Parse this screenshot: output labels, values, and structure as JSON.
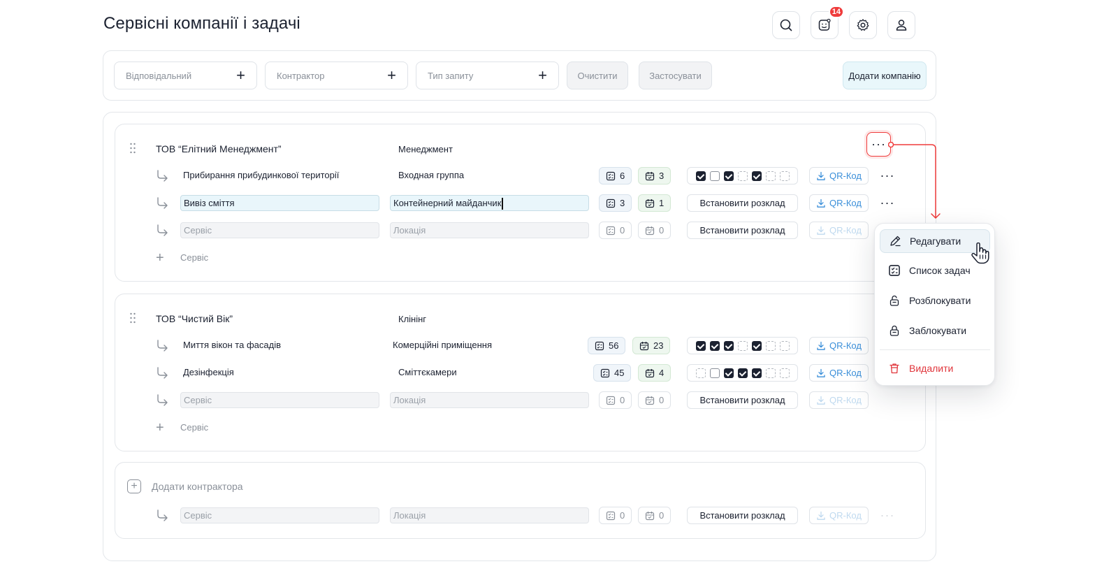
{
  "header": {
    "title": "Сервісні компанії і задачі",
    "notifications_badge": "14"
  },
  "filters": {
    "responsible": "Відповідальний",
    "contractor": "Контрактор",
    "request_type": "Тип запиту",
    "clear_label": "Очистити",
    "apply_label": "Застосувати",
    "add_company_label": "Додати компанію"
  },
  "companies": [
    {
      "name": "ТОВ “Елітний Менеджмент”",
      "category": "Менеджмент",
      "services": [
        {
          "name": "Прибирання прибудинкової території",
          "location": "Входная группа",
          "tasks": "6",
          "schedules": "3",
          "days": [
            "on",
            "off",
            "on",
            "dash",
            "on",
            "dash",
            "dash"
          ],
          "qr_label": "QR-Код"
        },
        {
          "name": "Вивіз сміття",
          "location": "Контейнерний майданчик",
          "tasks": "3",
          "schedules": "1",
          "schedule_label": "Встановити розклад",
          "qr_label": "QR-Код"
        },
        {
          "name_placeholder": "Сервіс",
          "location_placeholder": "Локація",
          "tasks": "0",
          "schedules": "0",
          "schedule_label": "Встановити розклад",
          "qr_label": "QR-Код"
        }
      ],
      "add_service_label": "Сервіс"
    },
    {
      "name": "ТОВ “Чистий Вік”",
      "category": "Клінінг",
      "services": [
        {
          "name": "Миття вікон та фасадів",
          "location": "Комерційні приміщення",
          "tasks": "56",
          "schedules": "23",
          "days": [
            "on",
            "on",
            "on",
            "dash",
            "on",
            "dash",
            "dash"
          ],
          "qr_label": "QR-Код"
        },
        {
          "name": "Дезінфекція",
          "location": "Сміттєкамери",
          "tasks": "45",
          "schedules": "4",
          "days": [
            "dash",
            "off",
            "on",
            "on",
            "on",
            "dash",
            "dash"
          ],
          "qr_label": "QR-Код"
        },
        {
          "name_placeholder": "Сервіс",
          "location_placeholder": "Локація",
          "tasks": "0",
          "schedules": "0",
          "schedule_label": "Встановити розклад",
          "qr_label": "QR-Код"
        }
      ],
      "add_service_label": "Сервіс"
    }
  ],
  "add_contractor": {
    "label": "Додати контрактора",
    "service_placeholder": "Сервіс",
    "location_placeholder": "Локація",
    "tasks": "0",
    "schedules": "0",
    "schedule_label": "Встановити розклад",
    "qr_label": "QR-Код"
  },
  "context_menu": {
    "edit": "Редагувати",
    "task_list": "Список задач",
    "unlock": "Розблокувати",
    "lock": "Заблокувати",
    "delete": "Видалити"
  },
  "colors": {
    "accent_red": "#ef3b3b",
    "link_blue": "#3b8fd9",
    "text_dark": "#1b2130"
  }
}
